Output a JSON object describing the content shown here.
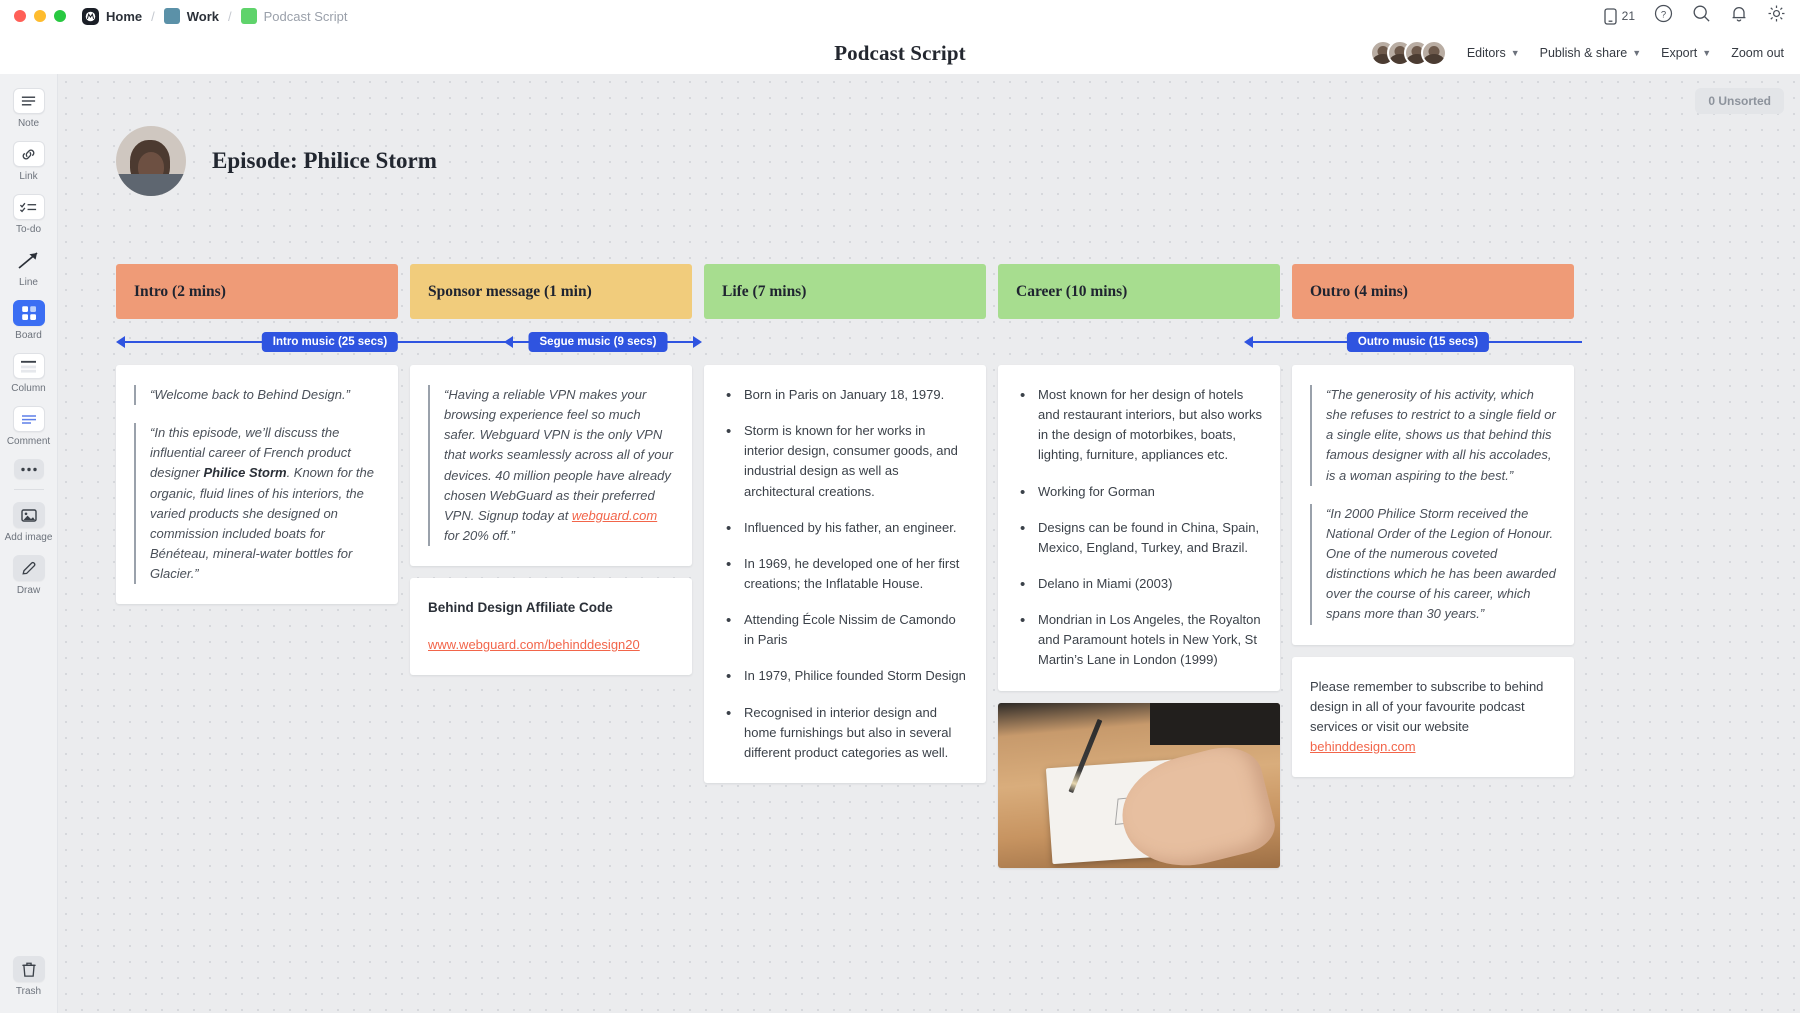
{
  "titlebar": {
    "breadcrumbs": [
      {
        "label": "Home",
        "icon": "milanote-logo-icon",
        "muted": false
      },
      {
        "label": "Work",
        "icon": "blue-square-icon",
        "muted": false
      },
      {
        "label": "Podcast Script",
        "icon": "green-square-icon",
        "muted": true
      }
    ],
    "separator": "/",
    "notification_count": "21",
    "icons": [
      "mobile-icon",
      "help-icon",
      "search-icon",
      "bell-icon",
      "gear-icon"
    ]
  },
  "header": {
    "title": "Podcast Script",
    "editors_label": "Editors",
    "publish_label": "Publish & share",
    "export_label": "Export",
    "zoom_label": "Zoom out",
    "avatar_count": 4
  },
  "sidebar": {
    "tools": [
      {
        "label": "Note",
        "icon": "note-icon"
      },
      {
        "label": "Link",
        "icon": "link-icon"
      },
      {
        "label": "To-do",
        "icon": "todo-icon"
      },
      {
        "label": "Line",
        "icon": "line-arrow-icon"
      },
      {
        "label": "Board",
        "icon": "board-icon",
        "active": true
      },
      {
        "label": "Column",
        "icon": "column-icon"
      },
      {
        "label": "Comment",
        "icon": "comment-icon"
      },
      {
        "label": "",
        "icon": "more-dots-icon"
      },
      {
        "label": "Add image",
        "icon": "add-image-icon"
      },
      {
        "label": "Draw",
        "icon": "draw-pencil-icon"
      }
    ],
    "trash_label": "Trash",
    "trash_icon": "trash-icon"
  },
  "canvas": {
    "unsorted_badge": "0 Unsorted",
    "episode_title": "Episode: Philice Storm",
    "avatar_icon": "person-portrait-avatar"
  },
  "colors": {
    "intro": "#ef9b77",
    "sponsor": "#f1cc7c",
    "life": "#a7dd8f",
    "career": "#a7dd8f",
    "outro": "#ef9b77",
    "arrow": "#2f54e0",
    "link": "#f2654a",
    "accent_blue": "#3b6ef3"
  },
  "arrows": [
    {
      "label": "Intro music (25 secs)"
    },
    {
      "label": "Segue music (9 secs)"
    },
    {
      "label": "Outro music (15 secs)"
    }
  ],
  "columns": [
    {
      "id": "intro",
      "header": "Intro (2 mins)",
      "color_key": "intro",
      "cards": [
        {
          "type": "quotes",
          "quotes": [
            {
              "text": "“Welcome back to Behind Design.”"
            },
            {
              "pre": "“In this episode, we’ll discuss the influential career of French product designer ",
              "bold": "Philice Storm",
              "post": ". Known for the organic, fluid lines of his interiors, the varied products she designed on commission included boats for Bénéteau, mineral-water bottles for Glacier.”"
            }
          ]
        }
      ]
    },
    {
      "id": "sponsor",
      "header": "Sponsor message (1 min)",
      "color_key": "sponsor",
      "cards": [
        {
          "type": "quote-link",
          "pre": "“Having a reliable VPN makes your browsing experience feel so much safer. Webguard VPN is the only VPN that works seamlessly across all of your devices. 40 million people have already chosen WebGuard as their preferred VPN. Signup today at ",
          "link": "webguard.com",
          "post": " for 20% off.”"
        },
        {
          "type": "title-link",
          "title": "Behind Design Affiliate Code",
          "link": "www.webguard.com/behinddesign20"
        }
      ]
    },
    {
      "id": "life",
      "header": "Life (7 mins)",
      "color_key": "life",
      "cards": [
        {
          "type": "bullets",
          "items": [
            "Born in Paris on January 18, 1979.",
            "Storm is known for her works in interior design, consumer goods, and industrial design as well as architectural creations.",
            "Influenced by his father, an engineer.",
            "In 1969, he developed one of her first creations; the Inflatable House.",
            "Attending École Nissim de Camondo in Paris",
            "In 1979, Philice founded Storm Design",
            "Recognised in interior design and home furnishings but also in several different product categories as well."
          ]
        }
      ]
    },
    {
      "id": "career",
      "header": "Career (10 mins)",
      "color_key": "career",
      "cards": [
        {
          "type": "bullets",
          "items": [
            "Most known for her design of hotels and restaurant interiors, but also works in the design of motorbikes, boats, lighting, furniture, appliances etc.",
            "Working for Gorman",
            "Designs can be found in China, Spain, Mexico, England, Turkey, and Brazil.",
            "Delano in Miami (2003)",
            "Mondrian in Los Angeles, the Royalton and Paramount hotels in New York, St Martin’s Lane in London (1999)"
          ]
        },
        {
          "type": "photo",
          "alt": "hand-sketching-on-paper-photo"
        }
      ]
    },
    {
      "id": "outro",
      "header": "Outro (4 mins)",
      "color_key": "outro",
      "cards": [
        {
          "type": "quotes",
          "quotes": [
            {
              "text": "“The generosity of his activity, which she refuses to restrict to a single field or a single elite, shows us that behind this famous designer with all his accolades, is a woman aspiring to the best.”"
            },
            {
              "text": "“In 2000 Philice Storm received the National Order of the Legion of Honour. One of the numerous coveted distinctions which he has been awarded over the course of his career, which spans more than 30 years.”"
            }
          ]
        },
        {
          "type": "text-link",
          "pre": "Please remember to subscribe to behind design in all of your favourite podcast services or visit our website ",
          "link": "behinddesign.com"
        }
      ]
    }
  ]
}
